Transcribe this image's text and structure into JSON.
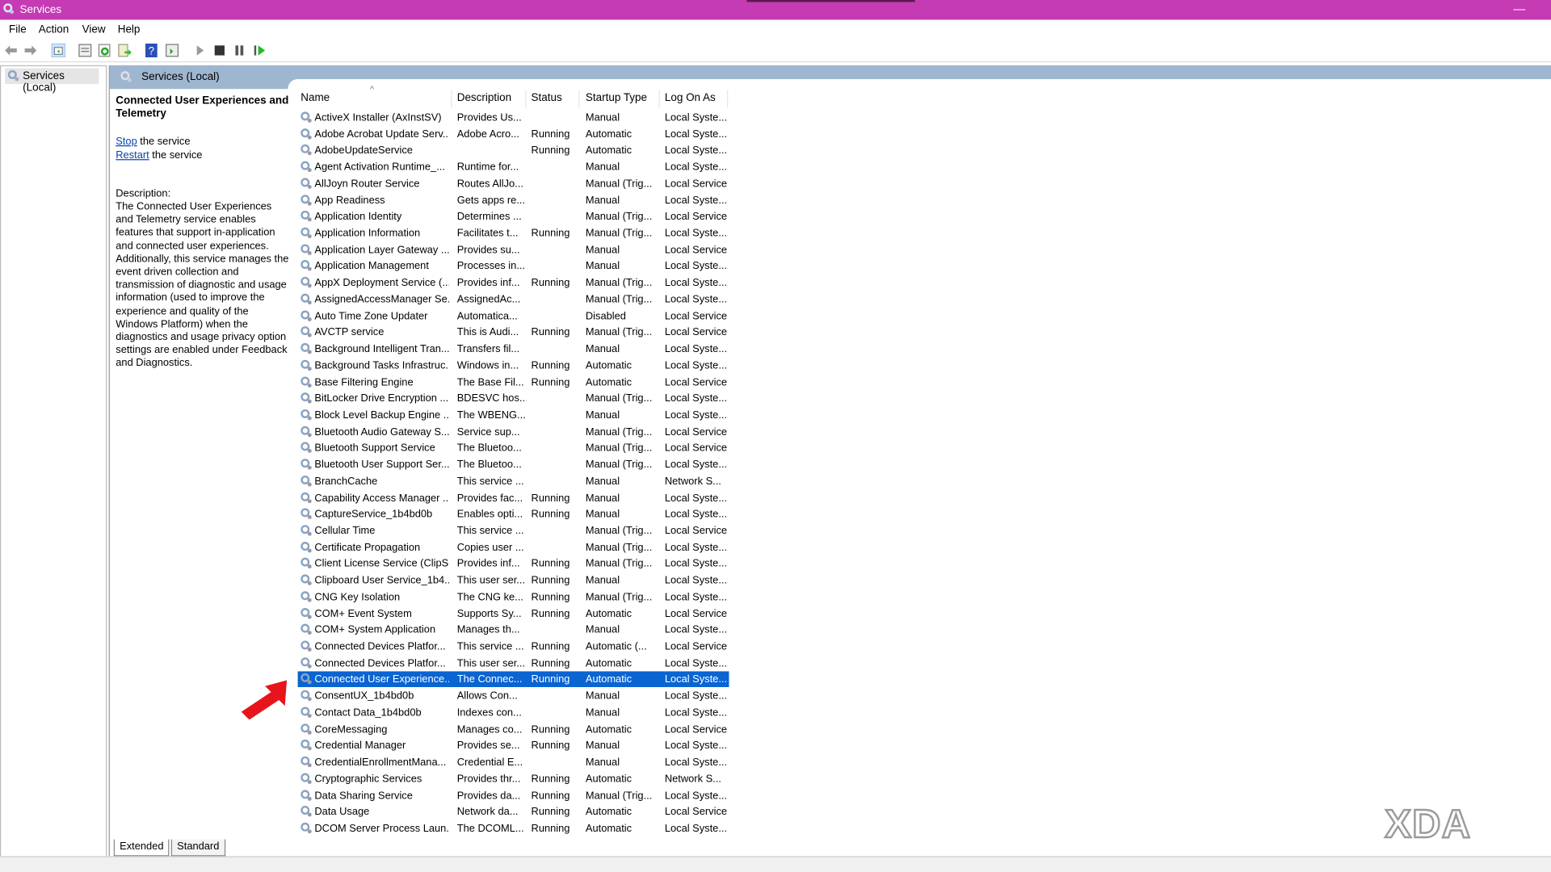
{
  "window": {
    "title": "Services",
    "minimize": "—"
  },
  "menu": [
    "File",
    "Action",
    "View",
    "Help"
  ],
  "toolbar": [
    "back-icon",
    "forward-icon",
    "show-hide-console-tree-icon",
    "properties-icon",
    "refresh-icon",
    "export-list-icon",
    "help-icon",
    "show-action-pane-icon",
    "start-service-icon",
    "stop-service-icon",
    "pause-service-icon",
    "resume-service-icon"
  ],
  "tree": {
    "root": "Services (Local)"
  },
  "panel": {
    "header": "Services (Local)",
    "selected_title": "Connected User Experiences and Telemetry",
    "stop_link": "Stop",
    "stop_rest": " the service",
    "restart_link": "Restart",
    "restart_rest": " the service",
    "desc_label": "Description:",
    "desc_text": "The Connected User Experiences and Telemetry service enables features that support in-application and connected user experiences. Additionally, this service manages the event driven collection and transmission of diagnostic and usage information (used to improve the experience and quality of the Windows Platform) when the diagnostics and usage privacy option settings are enabled under Feedback and Diagnostics."
  },
  "columns": [
    "Name",
    "Description",
    "Status",
    "Startup Type",
    "Log On As"
  ],
  "sort_indicator": "^",
  "rows": [
    [
      "ActiveX Installer (AxInstSV)",
      "Provides Us...",
      "",
      "Manual",
      "Local Syste..."
    ],
    [
      "Adobe Acrobat Update Serv...",
      "Adobe Acro...",
      "Running",
      "Automatic",
      "Local Syste..."
    ],
    [
      "AdobeUpdateService",
      "",
      "Running",
      "Automatic",
      "Local Syste..."
    ],
    [
      "Agent Activation Runtime_...",
      "Runtime for...",
      "",
      "Manual",
      "Local Syste..."
    ],
    [
      "AllJoyn Router Service",
      "Routes AllJo...",
      "",
      "Manual (Trig...",
      "Local Service"
    ],
    [
      "App Readiness",
      "Gets apps re...",
      "",
      "Manual",
      "Local Syste..."
    ],
    [
      "Application Identity",
      "Determines ...",
      "",
      "Manual (Trig...",
      "Local Service"
    ],
    [
      "Application Information",
      "Facilitates t...",
      "Running",
      "Manual (Trig...",
      "Local Syste..."
    ],
    [
      "Application Layer Gateway ...",
      "Provides su...",
      "",
      "Manual",
      "Local Service"
    ],
    [
      "Application Management",
      "Processes in...",
      "",
      "Manual",
      "Local Syste..."
    ],
    [
      "AppX Deployment Service (...",
      "Provides inf...",
      "Running",
      "Manual (Trig...",
      "Local Syste..."
    ],
    [
      "AssignedAccessManager Se...",
      "AssignedAc...",
      "",
      "Manual (Trig...",
      "Local Syste..."
    ],
    [
      "Auto Time Zone Updater",
      "Automatica...",
      "",
      "Disabled",
      "Local Service"
    ],
    [
      "AVCTP service",
      "This is Audi...",
      "Running",
      "Manual (Trig...",
      "Local Service"
    ],
    [
      "Background Intelligent Tran...",
      "Transfers fil...",
      "",
      "Manual",
      "Local Syste..."
    ],
    [
      "Background Tasks Infrastruc...",
      "Windows in...",
      "Running",
      "Automatic",
      "Local Syste..."
    ],
    [
      "Base Filtering Engine",
      "The Base Fil...",
      "Running",
      "Automatic",
      "Local Service"
    ],
    [
      "BitLocker Drive Encryption ...",
      "BDESVC hos...",
      "",
      "Manual (Trig...",
      "Local Syste..."
    ],
    [
      "Block Level Backup Engine ...",
      "The WBENG...",
      "",
      "Manual",
      "Local Syste..."
    ],
    [
      "Bluetooth Audio Gateway S...",
      "Service sup...",
      "",
      "Manual (Trig...",
      "Local Service"
    ],
    [
      "Bluetooth Support Service",
      "The Bluetoo...",
      "",
      "Manual (Trig...",
      "Local Service"
    ],
    [
      "Bluetooth User Support Ser...",
      "The Bluetoo...",
      "",
      "Manual (Trig...",
      "Local Syste..."
    ],
    [
      "BranchCache",
      "This service ...",
      "",
      "Manual",
      "Network S..."
    ],
    [
      "Capability Access Manager ...",
      "Provides fac...",
      "Running",
      "Manual",
      "Local Syste..."
    ],
    [
      "CaptureService_1b4bd0b",
      "Enables opti...",
      "Running",
      "Manual",
      "Local Syste..."
    ],
    [
      "Cellular Time",
      "This service ...",
      "",
      "Manual (Trig...",
      "Local Service"
    ],
    [
      "Certificate Propagation",
      "Copies user ...",
      "",
      "Manual (Trig...",
      "Local Syste..."
    ],
    [
      "Client License Service (ClipS...",
      "Provides inf...",
      "Running",
      "Manual (Trig...",
      "Local Syste..."
    ],
    [
      "Clipboard User Service_1b4...",
      "This user ser...",
      "Running",
      "Manual",
      "Local Syste..."
    ],
    [
      "CNG Key Isolation",
      "The CNG ke...",
      "Running",
      "Manual (Trig...",
      "Local Syste..."
    ],
    [
      "COM+ Event System",
      "Supports Sy...",
      "Running",
      "Automatic",
      "Local Service"
    ],
    [
      "COM+ System Application",
      "Manages th...",
      "",
      "Manual",
      "Local Syste..."
    ],
    [
      "Connected Devices Platfor...",
      "This service ...",
      "Running",
      "Automatic (...",
      "Local Service"
    ],
    [
      "Connected Devices Platfor...",
      "This user ser...",
      "Running",
      "Automatic",
      "Local Syste..."
    ],
    [
      "Connected User Experience...",
      "The Connec...",
      "Running",
      "Automatic",
      "Local Syste..."
    ],
    [
      "ConsentUX_1b4bd0b",
      "Allows Con...",
      "",
      "Manual",
      "Local Syste..."
    ],
    [
      "Contact Data_1b4bd0b",
      "Indexes con...",
      "",
      "Manual",
      "Local Syste..."
    ],
    [
      "CoreMessaging",
      "Manages co...",
      "Running",
      "Automatic",
      "Local Service"
    ],
    [
      "Credential Manager",
      "Provides se...",
      "Running",
      "Manual",
      "Local Syste..."
    ],
    [
      "CredentialEnrollmentMana...",
      "Credential E...",
      "",
      "Manual",
      "Local Syste..."
    ],
    [
      "Cryptographic Services",
      "Provides thr...",
      "Running",
      "Automatic",
      "Network S..."
    ],
    [
      "Data Sharing Service",
      "Provides da...",
      "Running",
      "Manual (Trig...",
      "Local Syste..."
    ],
    [
      "Data Usage",
      "Network da...",
      "Running",
      "Automatic",
      "Local Service"
    ],
    [
      "DCOM Server Process Laun...",
      "The DCOML...",
      "Running",
      "Automatic",
      "Local Syste..."
    ]
  ],
  "selected_row": 34,
  "tabs": [
    "Extended",
    "Standard"
  ],
  "colors": {
    "titlebar": "#c43bb3",
    "selection": "#0a64d2",
    "header": "#9fb6d0",
    "arrow": "#e8141b"
  },
  "watermark": "XDA"
}
